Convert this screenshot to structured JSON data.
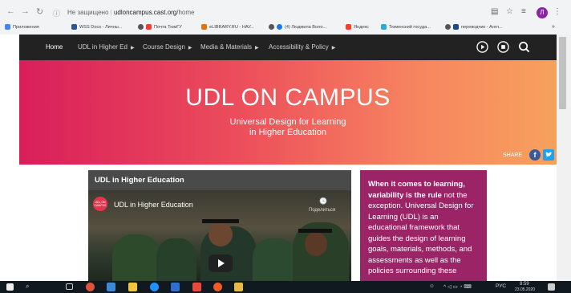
{
  "browser": {
    "security_label": "Не защищено",
    "url_host": "udloncampus.cast.org",
    "url_path": "/home",
    "profile_initial": "Л",
    "bookmarks": [
      "Приложения",
      "WSS Docs - Личны...",
      "Почта ТюмГУ",
      "eLIBRARY.RU - НАУ...",
      "(4) Людмила Воло...",
      "Яндекс",
      "Тюменский госуда...",
      "переводчик - Англ..."
    ]
  },
  "nav": {
    "items": [
      "Home",
      "UDL in Higher Ed",
      "Course Design",
      "Media & Materials",
      "Accessibility & Policy"
    ]
  },
  "hero": {
    "title": "UDL ON CAMPUS",
    "subtitle_line1": "Universal Design for Learning",
    "subtitle_line2": "in Higher Education",
    "share_label": "SHARE"
  },
  "video_card": {
    "heading": "UDL in Higher Education",
    "video_title": "UDL in Higher Education",
    "logo_text": "UDL ON CAMPUS",
    "watch_later": "Смотреть позже",
    "share_text": "Поделиться"
  },
  "info": {
    "bold_text": "When it comes to learning, variability is the rule",
    "body_text": " not the exception. Universal Design for Learning (UDL) is an educational framework that guides the design of learning goals, materials, methods, and assessments as well as the policies surrounding these"
  },
  "taskbar": {
    "lang": "РУС",
    "time": "8:59",
    "date": "23.05.2020"
  },
  "colors": {
    "hero_start": "#d81e5b",
    "hero_end": "#f7a15d",
    "info_bg": "#9b2467",
    "navbar_bg": "#222222"
  }
}
